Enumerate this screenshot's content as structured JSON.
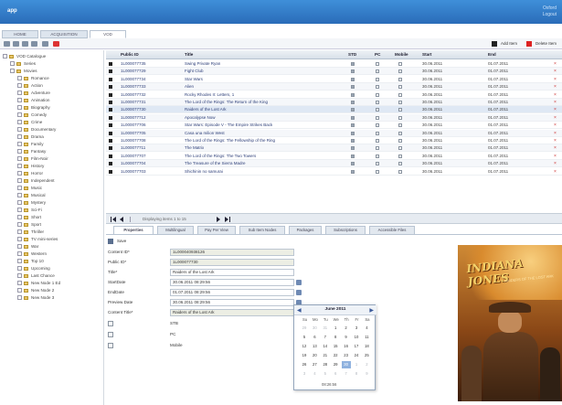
{
  "app": {
    "brand": "app",
    "user_line1": "Oxford",
    "user_line2": "Logout"
  },
  "tabs": [
    {
      "label": "HOME"
    },
    {
      "label": "ACQUISITION"
    },
    {
      "label": "VOD"
    }
  ],
  "toolbar": {
    "add_label": "Add Item",
    "delete_label": "Delete Item"
  },
  "tree": {
    "root": "VOD Catalogue",
    "nodes": [
      "Series",
      "Movies"
    ],
    "genres": [
      "Romance",
      "Action",
      "Adventure",
      "Animation",
      "Biography",
      "Comedy",
      "Crime",
      "Documentary",
      "Drama",
      "Family",
      "Fantasy",
      "Film-Noir",
      "History",
      "Horror",
      "Independent",
      "Music",
      "Musical",
      "Mystery",
      "Sci-Fi",
      "Short",
      "Sport",
      "Thriller",
      "TV mini-series",
      "War",
      "Western",
      "Top 10",
      "Upcoming",
      "Last Chance",
      "New Node 1 Ed",
      "New Node 2",
      "New Node 3"
    ]
  },
  "grid": {
    "columns": {
      "public_id": "Public ID",
      "title": "Title",
      "std": "STD",
      "pc": "PC",
      "mobile": "Mobile",
      "start": "Start",
      "end": "End"
    },
    "rows": [
      {
        "id": "1L000077735",
        "title": "Swing Private Ryan",
        "start": "30.06.2011",
        "end": "01.07.2011"
      },
      {
        "id": "1L000077729",
        "title": "Fight Club",
        "start": "30.06.2011",
        "end": "01.07.2011"
      },
      {
        "id": "1L000077734",
        "title": "Star Wars",
        "start": "30.06.2011",
        "end": "01.07.2011"
      },
      {
        "id": "1L000077733",
        "title": "Alien",
        "start": "30.06.2011",
        "end": "01.07.2011"
      },
      {
        "id": "1L000077732",
        "title": "Rocky Rhodes II: Letters, 1",
        "start": "30.06.2011",
        "end": "01.07.2011"
      },
      {
        "id": "1L000077731",
        "title": "The Lord of the Rings: The Return of the King",
        "start": "30.06.2011",
        "end": "01.07.2011"
      },
      {
        "id": "1L000077730",
        "title": "Raiders of the Lost Ark",
        "start": "30.06.2011",
        "end": "01.07.2011"
      },
      {
        "id": "1L000077712",
        "title": "Apocalypse Now",
        "start": "30.06.2011",
        "end": "01.07.2011"
      },
      {
        "id": "1L000077706",
        "title": "Star Wars: Episode V - The Empire Strikes Back",
        "start": "30.06.2011",
        "end": "01.07.2011"
      },
      {
        "id": "1L000077705",
        "title": "Casa una milion West",
        "start": "30.06.2011",
        "end": "01.07.2011"
      },
      {
        "id": "1L000077708",
        "title": "The Lord of the Rings: The Fellowship of the Ring",
        "start": "30.06.2011",
        "end": "01.07.2011"
      },
      {
        "id": "1L000077711",
        "title": "The Matrix",
        "start": "30.06.2011",
        "end": "01.07.2011"
      },
      {
        "id": "1L000077707",
        "title": "The Lord of the Rings: The Two Towers",
        "start": "30.06.2011",
        "end": "01.07.2011"
      },
      {
        "id": "1L000077704",
        "title": "The Treasure of the Sierra Madre",
        "start": "30.06.2011",
        "end": "01.07.2011"
      },
      {
        "id": "1L000077703",
        "title": "Shichinin no samurai",
        "start": "30.06.2011",
        "end": "01.07.2011"
      }
    ]
  },
  "pager": {
    "info": "Displaying items 1 to 15"
  },
  "panel_tabs": [
    {
      "label": "Properties"
    },
    {
      "label": "Multilingual"
    },
    {
      "label": "Pay Per View"
    },
    {
      "label": "Sub Item Nodes"
    },
    {
      "label": "Packages"
    },
    {
      "label": "Subscriptions"
    },
    {
      "label": "Accessible Files"
    }
  ],
  "form": {
    "save_label": "Save",
    "fields": [
      {
        "label": "Content ID*",
        "value": "1L000040938126"
      },
      {
        "label": "Public ID*",
        "value": "1L000077730"
      },
      {
        "label": "Title*",
        "value": "Raiders of the Lost Ark"
      },
      {
        "label": "StartDate",
        "value": "30.06.2011 08:29:56"
      },
      {
        "label": "EndDate",
        "value": "01.07.2011 08:29:56"
      },
      {
        "label": "Preview Date",
        "value": "30.06.2011 08:29:56"
      },
      {
        "label": "Content Title*",
        "value": "Raiders of the Lost Ark"
      }
    ],
    "checkboxes": [
      {
        "label": "STB"
      },
      {
        "label": "PC"
      },
      {
        "label": "Mobile"
      }
    ]
  },
  "calendar": {
    "month_label": "June 2011",
    "weekdays": [
      "Su",
      "Mo",
      "Tu",
      "We",
      "Th",
      "Fr",
      "Sa"
    ],
    "weeks": [
      [
        "29",
        "30",
        "31",
        "1",
        "2",
        "3",
        "4"
      ],
      [
        "5",
        "6",
        "7",
        "8",
        "9",
        "10",
        "11"
      ],
      [
        "12",
        "13",
        "14",
        "15",
        "16",
        "17",
        "18"
      ],
      [
        "19",
        "20",
        "21",
        "22",
        "23",
        "24",
        "25"
      ],
      [
        "26",
        "27",
        "28",
        "29",
        "30",
        "1",
        "2"
      ],
      [
        "3",
        "4",
        "5",
        "6",
        "7",
        "8",
        "9"
      ]
    ],
    "time": "08:26:56",
    "selected": "30"
  },
  "poster": {
    "title": "INDIANA JONES",
    "subtitle": "RAIDERS OF THE LOST ARK"
  }
}
